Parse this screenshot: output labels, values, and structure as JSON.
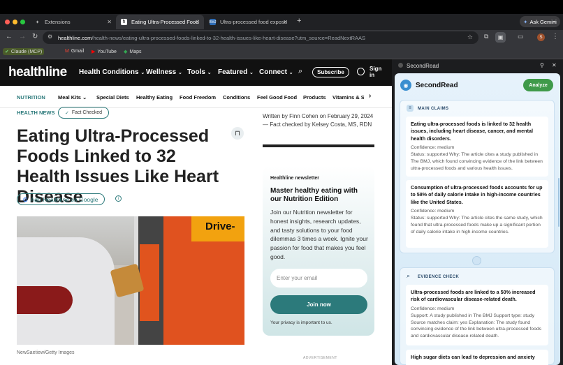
{
  "browser": {
    "tabs": [
      {
        "title": "Extensions",
        "active": false
      },
      {
        "title": "Eating Ultra-Processed Foods",
        "active": true
      },
      {
        "title": "Ultra-processed food exposu",
        "active": false
      }
    ],
    "ask_gemini": "Ask Gemini",
    "url_host": "healthline.com",
    "url_path": "/health-news/eating-ultra-processed-foods-linked-to-32-health-issues-like-heart-disease?utm_source=ReadNextRAAS",
    "bookmarks": [
      "Claude (MCP)",
      "Gmail",
      "YouTube",
      "Maps"
    ],
    "profile_initial": "S"
  },
  "site": {
    "logo": "healthline",
    "nav": [
      "Health Conditions",
      "Wellness",
      "Tools",
      "Featured",
      "Connect"
    ],
    "subscribe": "Subscribe",
    "sign_in": "Sign in",
    "subnav": [
      "NUTRITION",
      "Meal Kits",
      "Special Diets",
      "Healthy Eating",
      "Food Freedom",
      "Conditions",
      "Feel Good Food",
      "Products",
      "Vitamins & Su"
    ]
  },
  "article": {
    "category": "HEALTH NEWS",
    "fact_checked": "Fact Checked",
    "title": "Eating Ultra-Processed Foods Linked to 32 Health Issues Like Heart Disease",
    "add_google": "Add Healthline on Google",
    "byline_written": "Written by",
    "author": "Finn Cohen",
    "byline_on": "on February 29, 2024 —",
    "fact_checked_by": "Fact checked",
    "byline_by": "by",
    "checker": "Kelsey Costa, MS, RDN",
    "image_text": "Drive-",
    "image_credit": "NewSaetiew/Getty Images",
    "advertisement": "ADVERTISEMENT"
  },
  "newsletter": {
    "label": "Healthline newsletter",
    "heading": "Master healthy eating with our Nutrition Edition",
    "body": "Join our Nutrition newsletter for honest insights, research updates, and tasty solutions to your food dilemmas 3 times a week. Ignite your passion for food that makes you feel good.",
    "email_placeholder": "Enter your email",
    "join": "Join now",
    "privacy_pre": "Your",
    "privacy_link": "privacy",
    "privacy_post": "is important to us."
  },
  "secondread": {
    "window_title": "SecondRead",
    "title": "SecondRead",
    "analyze": "Analyze",
    "main_claims_label": "MAIN CLAIMS",
    "claims": [
      {
        "heading": "Eating ultra-processed foods is linked to 32 health issues, including heart disease, cancer, and mental health disorders.",
        "confidence": "Confidence: medium",
        "status": "Status: supported Why: The article cites a study published in The BMJ, which found convincing evidence of the link between ultra-processed foods and various health issues."
      },
      {
        "heading": "Consumption of ultra-processed foods accounts for up to 58% of daily calorie intake in high-income countries like the United States.",
        "confidence": "Confidence: medium",
        "status": "Status: supported Why: The article cites the same study, which found that ultra-processed foods make up a significant portion of daily calorie intake in high-income countries."
      }
    ],
    "evidence_label": "EVIDENCE CHECK",
    "evidence": [
      {
        "heading": "Ultra-processed foods are linked to a 50% increased risk of cardiovascular disease-related death.",
        "confidence": "Confidence: medium",
        "status": "Support: A study published in The BMJ Support type: study Source matches claim: yes Explanation: The study found convincing evidence of the link between ultra-processed foods and cardiovascular disease-related death."
      },
      {
        "heading": "High sugar diets can lead to depression and anxiety"
      }
    ]
  }
}
